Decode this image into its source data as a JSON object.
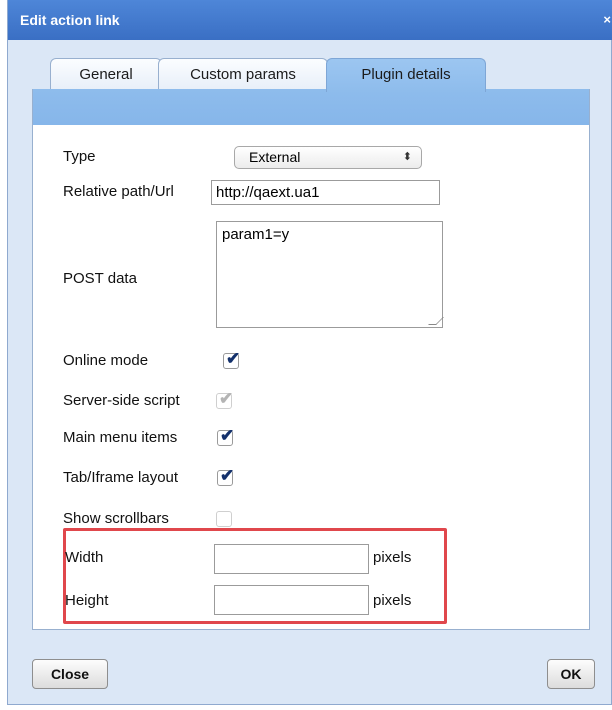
{
  "dialog": {
    "title": "Edit action link",
    "close_glyph": "×"
  },
  "tabs": [
    {
      "label": "General",
      "active": false
    },
    {
      "label": "Custom params",
      "active": false
    },
    {
      "label": "Plugin details",
      "active": true
    }
  ],
  "form": {
    "type": {
      "label": "Type",
      "value": "External",
      "arrows": "⬍"
    },
    "path": {
      "label": "Relative path/Url",
      "value": "http://qaext.ua1"
    },
    "post": {
      "label": "POST data",
      "value": "param1=y"
    },
    "online_mode": {
      "label": "Online mode",
      "checked": true,
      "enabled": true
    },
    "server_side": {
      "label": "Server-side script",
      "checked": true,
      "enabled": false
    },
    "main_menu": {
      "label": "Main menu items",
      "checked": true,
      "enabled": true
    },
    "tab_iframe": {
      "label": "Tab/Iframe layout",
      "checked": true,
      "enabled": true
    },
    "scrollbars": {
      "label": "Show scrollbars",
      "checked": false,
      "enabled": false
    },
    "width": {
      "label": "Width",
      "value": "",
      "unit": "pixels"
    },
    "height": {
      "label": "Height",
      "value": "",
      "unit": "pixels"
    },
    "tick_glyph": "✔"
  },
  "footer": {
    "close_label": "Close",
    "ok_label": "OK"
  },
  "colors": {
    "titlebar": "#4479cf",
    "active_tab": "#8ebcec",
    "highlight": "#e0474c"
  }
}
